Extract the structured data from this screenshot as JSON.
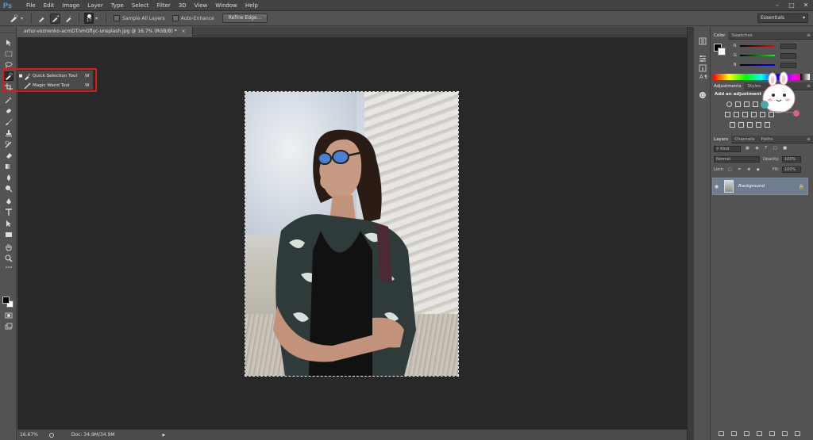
{
  "app": {
    "logo": "Ps"
  },
  "menu": [
    "File",
    "Edit",
    "Image",
    "Layer",
    "Type",
    "Select",
    "Filter",
    "3D",
    "View",
    "Window",
    "Help"
  ],
  "options_bar": {
    "brush_size": "17",
    "sample_all_layers": "Sample All Layers",
    "auto_enhance": "Auto-Enhance",
    "refine_edge": "Refine Edge...",
    "workspace": "Essentials"
  },
  "document": {
    "tab_title": "artur-voznenko-acmDTnmGflyc-unsplash.jpg @ 16.7% (RGB/8) *",
    "zoom": "16.67%",
    "doc_size": "Doc: 34.9M/34.9M"
  },
  "tool_flyout": {
    "items": [
      {
        "label": "Quick Selection Tool",
        "shortcut": "W",
        "selected": true
      },
      {
        "label": "Magic Wand Tool",
        "shortcut": "W",
        "selected": false
      }
    ]
  },
  "panels": {
    "color_tabs": [
      "Color",
      "Swatches"
    ],
    "color_channels": [
      "R",
      "G",
      "B"
    ],
    "adjust_tabs": [
      "Adjustments",
      "Styles"
    ],
    "adjust_title": "Add an adjustment",
    "layers_tabs": [
      "Layers",
      "Channels",
      "Paths"
    ],
    "layers": {
      "kind": "Kind",
      "blend_mode": "Normal",
      "opacity_label": "Opacity:",
      "opacity": "100%",
      "lock_label": "Lock:",
      "fill_label": "Fill:",
      "fill": "100%",
      "items": [
        {
          "name": "Background",
          "locked": true,
          "visible": true
        }
      ]
    }
  },
  "colors": {
    "accent_highlight": "#e01818",
    "selected_layer": "#6f7d8f",
    "canvas_bg": "#282828",
    "ui_bg": "#535353"
  }
}
